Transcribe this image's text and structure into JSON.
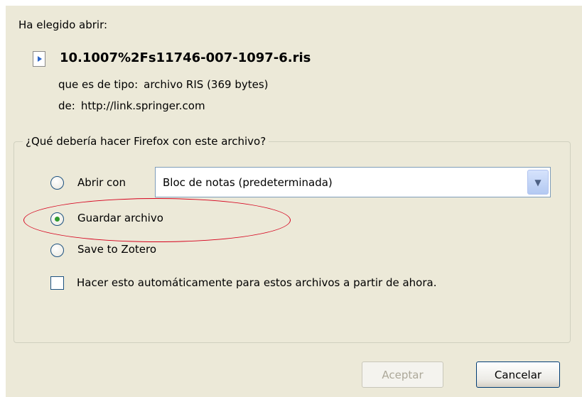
{
  "dialog": {
    "intro": "Ha elegido abrir:",
    "file": {
      "icon": "ris-file-icon",
      "name": "10.1007%2Fs11746-007-1097-6.ris",
      "type_label": "que es de tipo:",
      "type_value": "archivo RIS (369 bytes)",
      "from_label": "de:",
      "from_value": "http://link.springer.com"
    },
    "action_group": {
      "legend": "¿Qué debería hacer Firefox con este archivo?",
      "options": [
        {
          "label": "Abrir con",
          "selected": false
        },
        {
          "label": "Guardar archivo",
          "selected": true
        },
        {
          "label": "Save to Zotero",
          "selected": false
        }
      ],
      "open_with_app": "Bloc de notas (predeterminada)",
      "auto_checkbox": {
        "label": "Hacer esto automáticamente para estos archivos a partir de ahora.",
        "checked": false
      }
    },
    "buttons": {
      "ok": "Aceptar",
      "cancel": "Cancelar"
    },
    "annotation": {
      "color": "#d6001c",
      "target": "Guardar archivo"
    }
  }
}
